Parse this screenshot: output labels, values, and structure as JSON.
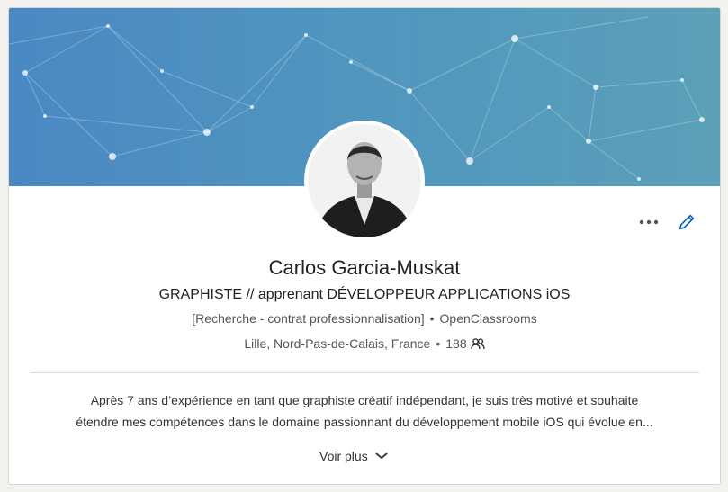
{
  "profile": {
    "name": "Carlos Garcia-Muskat",
    "headline": "GRAPHISTE // apprenant DÉVELOPPEUR APPLICATIONS iOS",
    "status": "[Recherche - contrat professionnalisation]",
    "company": "OpenClassrooms",
    "location": "Lille, Nord-Pas-de-Calais, France",
    "connections": "188",
    "summary_line1": "Après 7 ans d’expérience en tant que graphiste créatif indépendant, je suis très motivé et souhaite",
    "summary_line2": "étendre mes compétences dans le domaine passionnant du développement mobile iOS qui évolue en...",
    "see_more_label": "Voir plus",
    "separator": "•"
  },
  "icons": {
    "more": "more-horizontal-icon",
    "edit": "pencil-icon",
    "connections": "people-icon",
    "see_more": "chevron-down-icon"
  },
  "colors": {
    "banner_start": "#4a88c3",
    "banner_end": "#5aa0b8",
    "edit_icon": "#0a66c2",
    "text_primary": "#222222",
    "text_secondary": "#555555"
  }
}
